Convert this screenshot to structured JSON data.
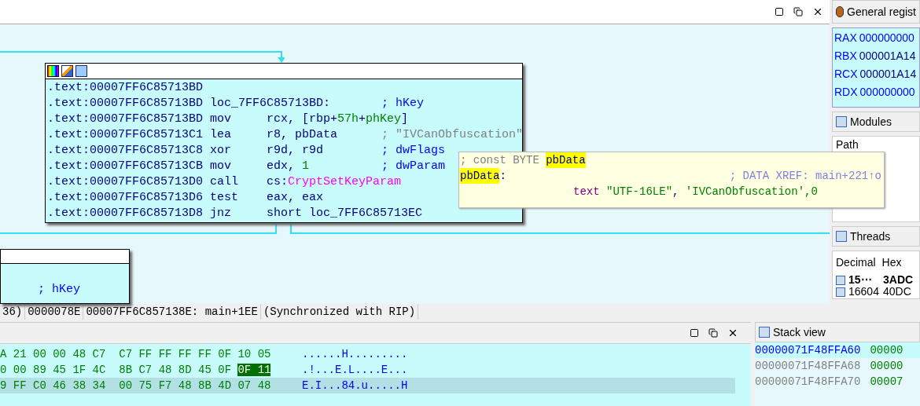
{
  "graph_view": {
    "main_block": {
      "lines": [
        {
          "address": ".text:00007FF6C85713BD"
        },
        {
          "address": ".text:00007FF6C85713BD",
          "parts": [
            {
              "text": "loc_7FF6C85713BD:",
              "kind": "label"
            }
          ],
          "comment_parts": [
            {
              "text": "; hKey",
              "kind": "name"
            }
          ]
        },
        {
          "address": ".text:00007FF6C85713BD",
          "mnemonic": "mov",
          "parts": [
            {
              "text": "rcx, [rbp+",
              "kind": "plain"
            },
            {
              "text": "57h",
              "kind": "number"
            },
            {
              "text": "+",
              "kind": "plain"
            },
            {
              "text": "phKey",
              "kind": "number"
            },
            {
              "text": "]",
              "kind": "plain"
            }
          ]
        },
        {
          "address": ".text:00007FF6C85713C1",
          "mnemonic": "lea",
          "parts": [
            {
              "text": "r8, pbData",
              "kind": "plain"
            }
          ],
          "comment_parts": [
            {
              "text": "; \"IVCanObfuscation\"",
              "kind": "string"
            }
          ]
        },
        {
          "address": ".text:00007FF6C85713C8",
          "mnemonic": "xor",
          "parts": [
            {
              "text": "r9d, r9d",
              "kind": "plain"
            }
          ],
          "comment_parts": [
            {
              "text": "; dwFlags",
              "kind": "name"
            }
          ]
        },
        {
          "address": ".text:00007FF6C85713CB",
          "mnemonic": "mov",
          "parts": [
            {
              "text": "edx, ",
              "kind": "plain"
            },
            {
              "text": "1",
              "kind": "number"
            }
          ],
          "comment_parts": [
            {
              "text": "; dwParam",
              "kind": "name"
            }
          ]
        },
        {
          "address": ".text:00007FF6C85713D0",
          "mnemonic": "call",
          "parts": [
            {
              "text": "cs:",
              "kind": "plain"
            },
            {
              "text": "CryptSetKeyParam",
              "kind": "import"
            }
          ]
        },
        {
          "address": ".text:00007FF6C85713D6",
          "mnemonic": "test",
          "parts": [
            {
              "text": "eax, eax",
              "kind": "plain"
            }
          ]
        },
        {
          "address": ".text:00007FF6C85713D8",
          "mnemonic": "jnz",
          "parts": [
            {
              "text": "short loc_7FF6C85713EC",
              "kind": "plain"
            }
          ]
        }
      ]
    },
    "lower_block": {
      "comment": "; hKey"
    },
    "tooltip": {
      "lines": [
        [
          {
            "text": "; const BYTE ",
            "kind": "comment"
          },
          {
            "text": "pbData",
            "kind": "highlight"
          }
        ],
        [
          {
            "text": "pbData",
            "kind": "highlight"
          },
          {
            "text": ":",
            "kind": "plain"
          },
          {
            "text": "; DATA XREF: main+221↑o",
            "kind": "xref"
          }
        ],
        [
          {
            "text": "text ",
            "kind": "directive"
          },
          {
            "text": "\"UTF-16LE\"",
            "kind": "string"
          },
          {
            "text": ", ",
            "kind": "plain"
          },
          {
            "text": "'IVCanObfuscation'",
            "kind": "string"
          },
          {
            "text": ",0",
            "kind": "string"
          }
        ]
      ]
    }
  },
  "status_bar": [
    "36)",
    "0000078E",
    "00007FF6C857138E: main+1EE",
    "(Synchronized with RIP)"
  ],
  "hex_view": {
    "rows": [
      {
        "bytes": "A 21 00 00 48 C7  C7 FF FF FF FF 0F 10 05",
        "highlight": "",
        "ascii": "......H.........",
        "selected": false
      },
      {
        "bytes": "0 00 89 45 1F 4C  8B C7 48 8D 45 0F ",
        "highlight": "0F 11",
        "ascii": ".!...E.L....E...",
        "selected": false
      },
      {
        "bytes": "9 FF C0 46 38 34  00 75 F7 48 8B 4D 07 48",
        "highlight": "",
        "ascii": "E.I...84.u.....H",
        "selected": true
      }
    ]
  },
  "registers": {
    "title": "General regist",
    "rows": [
      {
        "name": "RAX",
        "value": "000000000"
      },
      {
        "name": "RBX",
        "value": "000001A14"
      },
      {
        "name": "RCX",
        "value": "000001A14"
      },
      {
        "name": "RDX",
        "value": "000000000"
      }
    ]
  },
  "modules": {
    "title": "Modules",
    "column": "Path"
  },
  "threads": {
    "title": "Threads",
    "columns": [
      "Decimal",
      "Hex"
    ],
    "rows": [
      {
        "decimal": "15⋯",
        "hex": "3ADC",
        "selected": true
      },
      {
        "decimal": "16604",
        "hex": "40DC",
        "selected": false
      }
    ]
  },
  "stack_view": {
    "title": "Stack view",
    "rows": [
      {
        "address": "00000071F48FFA60",
        "value": "00000",
        "selected": true
      },
      {
        "address": "00000071F48FFA68",
        "value": "00000",
        "selected": false
      },
      {
        "address": "00000071F48FFA70",
        "value": "00007",
        "selected": false
      }
    ]
  }
}
